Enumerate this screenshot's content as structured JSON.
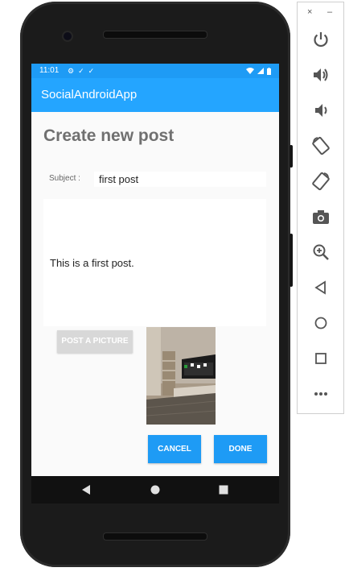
{
  "status_bar": {
    "time": "11:01",
    "left_icons": [
      "gear-icon",
      "download-check-icon",
      "download-check-icon"
    ],
    "right_icons": [
      "wifi-icon",
      "signal-icon",
      "battery-icon"
    ]
  },
  "app_bar": {
    "title": "SocialAndroidApp"
  },
  "page": {
    "heading": "Create new post",
    "subject_label": "Subject :",
    "subject_value": "first post",
    "body_text": "This is a first post."
  },
  "buttons": {
    "post_picture": "POST A PICTURE",
    "cancel": "CANCEL",
    "done": "DONE"
  },
  "navigation": [
    "back-icon",
    "home-icon",
    "recents-icon"
  ],
  "emulator_toolbar": {
    "window_controls": [
      "×",
      "–"
    ],
    "tools": [
      "power-icon",
      "volume-up-icon",
      "volume-down-icon",
      "rotate-left-icon",
      "rotate-right-icon",
      "camera-icon",
      "zoom-icon",
      "back-icon",
      "home-icon",
      "overview-icon",
      "more-icon"
    ]
  },
  "colors": {
    "status_bar": "#1e9bf5",
    "app_bar": "#24a5ff",
    "accent_button": "#1e9bf5",
    "disabled_button": "#d8d8d8"
  }
}
